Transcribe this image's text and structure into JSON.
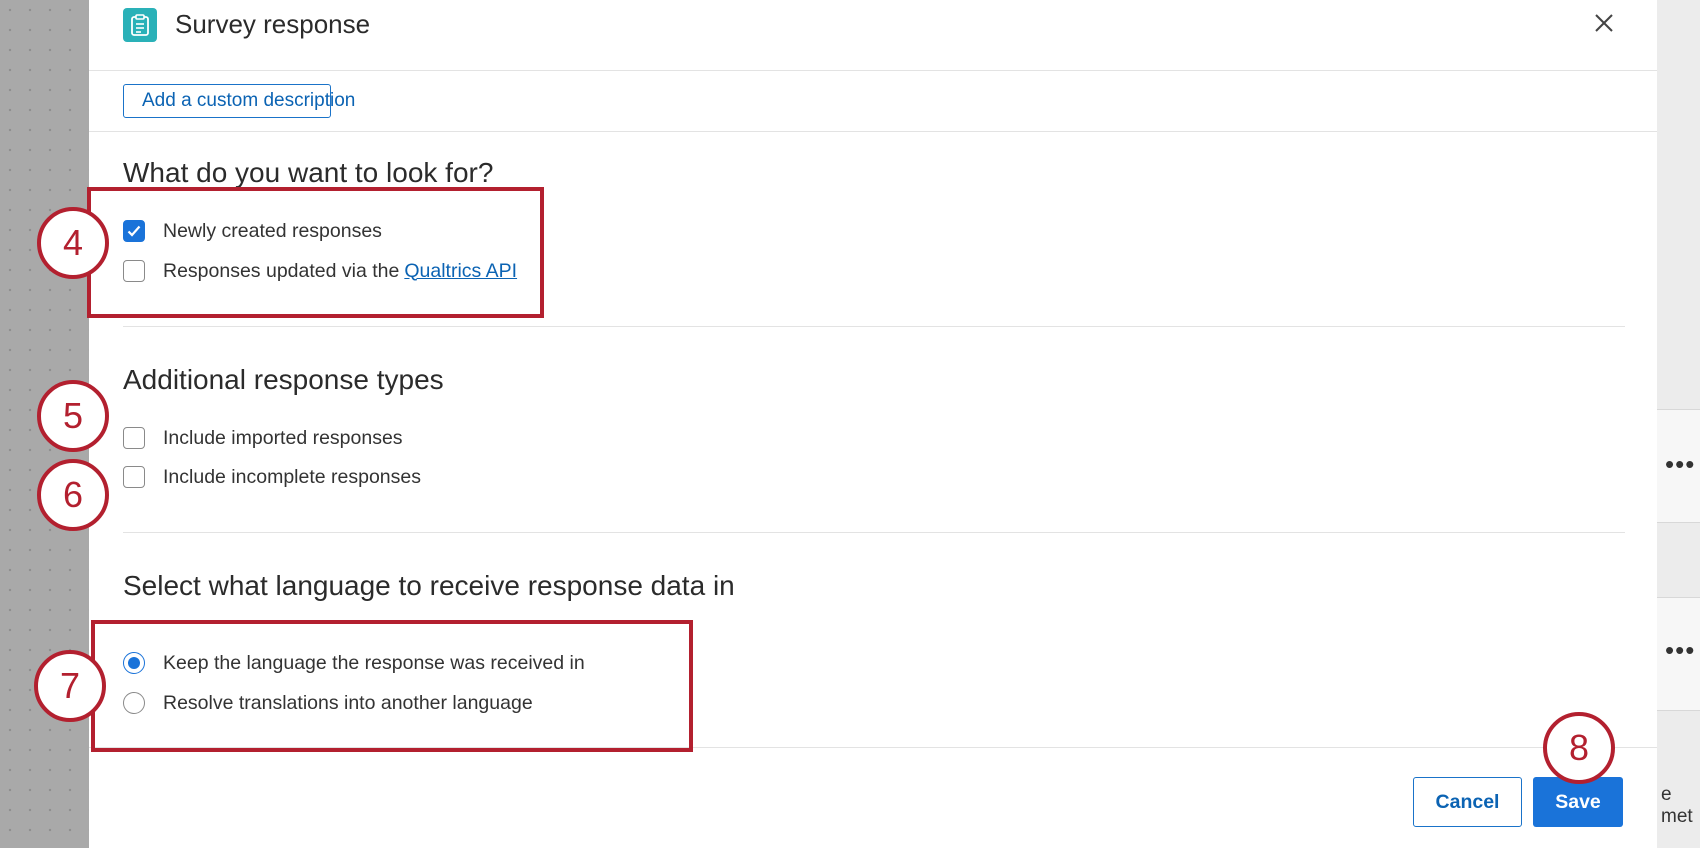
{
  "modal": {
    "title": "Survey response",
    "add_description_label": "Add a custom description"
  },
  "look_for": {
    "heading": "What do you want to look for?",
    "options": [
      {
        "label": "Newly created responses",
        "checked": true
      },
      {
        "label": "Responses updated via the",
        "link": "Qualtrics API",
        "checked": false
      }
    ]
  },
  "additional": {
    "heading": "Additional response types",
    "options": [
      {
        "label": "Include imported responses",
        "checked": false
      },
      {
        "label": "Include incomplete responses",
        "checked": false
      }
    ]
  },
  "language": {
    "heading": "Select what language to receive response data in",
    "options": [
      {
        "label": "Keep the language the response was received in",
        "selected": true
      },
      {
        "label": "Resolve translations into another language",
        "selected": false
      }
    ]
  },
  "footer": {
    "cancel_label": "Cancel",
    "save_label": "Save"
  },
  "annotations": [
    "4",
    "5",
    "6",
    "7",
    "8"
  ],
  "background": {
    "more_icon": "•••",
    "text_fragment": "e met"
  },
  "colors": {
    "accent": "#1a73d9",
    "annotation": "#b3202f",
    "header_icon": "#2ab1b8"
  }
}
